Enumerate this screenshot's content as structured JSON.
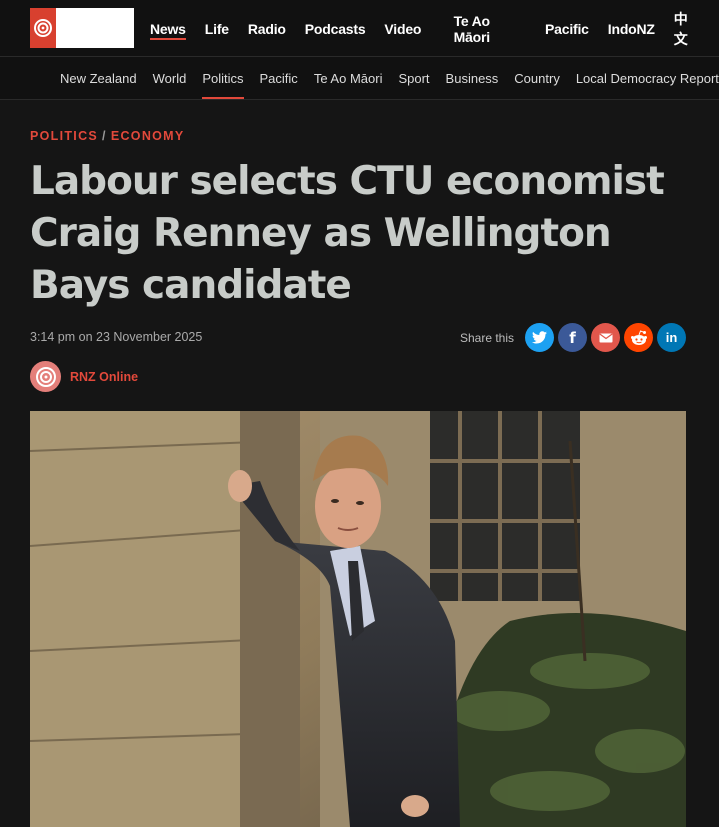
{
  "topnav": {
    "items": [
      {
        "label": "News",
        "active": true
      },
      {
        "label": "Life"
      },
      {
        "label": "Radio"
      },
      {
        "label": "Podcasts"
      },
      {
        "label": "Video"
      },
      {
        "label": "Te Ao Māori"
      },
      {
        "label": "Pacific"
      },
      {
        "label": "IndoNZ"
      },
      {
        "label": "中文"
      }
    ]
  },
  "secnav": {
    "items": [
      {
        "label": "New Zealand"
      },
      {
        "label": "World"
      },
      {
        "label": "Politics",
        "active": true
      },
      {
        "label": "Pacific"
      },
      {
        "label": "Te Ao Māori"
      },
      {
        "label": "Sport"
      },
      {
        "label": "Business"
      },
      {
        "label": "Country"
      },
      {
        "label": "Local Democracy Reporting"
      }
    ]
  },
  "article": {
    "kicker_1": "POLITICS",
    "kicker_sep": "/",
    "kicker_2": "ECONOMY",
    "headline": "Labour selects CTU economist Craig Renney as Wellington Bays candidate",
    "timestamp": "3:14 pm on 23 November 2025",
    "share_label": "Share this",
    "author": "RNZ Online"
  },
  "share_buttons": [
    {
      "name": "twitter",
      "glyph": "t",
      "color": "#1da1f2"
    },
    {
      "name": "facebook",
      "glyph": "f",
      "color": "#3b5998"
    },
    {
      "name": "email",
      "glyph": "✉",
      "color": "#e2574c"
    },
    {
      "name": "reddit",
      "glyph": "r",
      "color": "#ff4500"
    },
    {
      "name": "linkedin",
      "glyph": "in",
      "color": "#0077b5"
    }
  ],
  "colors": {
    "accent": "#e2493b",
    "headline": "#c8ccc9",
    "background": "#151515"
  }
}
